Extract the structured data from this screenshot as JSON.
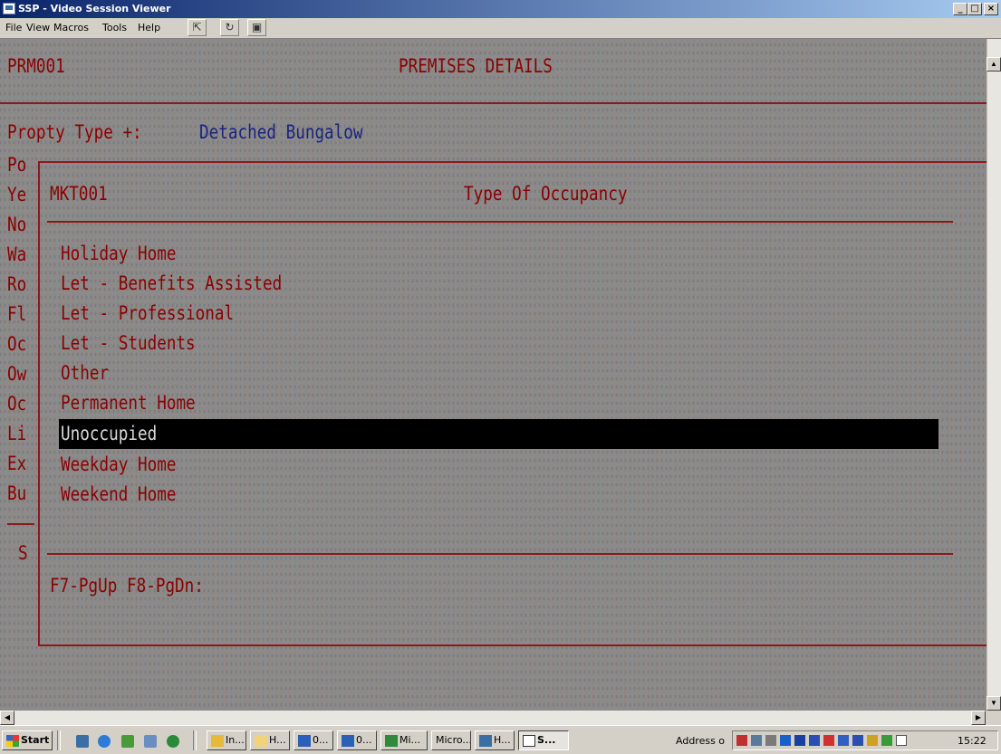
{
  "window": {
    "title": "SSP - Video Session Viewer"
  },
  "menu": [
    "File",
    "View",
    "Macros",
    "Tools",
    "Help"
  ],
  "screen": {
    "code": "PRM001",
    "title": "PREMISES DETAILS",
    "property_label": "Propty Type +:",
    "property_value": "Detached Bungalow",
    "side_labels": [
      "Po",
      "Ye",
      "No",
      "Wa",
      "Ro",
      "Fl",
      "Oc",
      "Ow",
      "Oc",
      "Li",
      "Ex",
      "Bu"
    ],
    "side_bottom": "S"
  },
  "popup": {
    "code": "MKT001",
    "title": "Type Of Occupancy",
    "options": [
      "Holiday Home",
      "Let - Benefits Assisted",
      "Let - Professional",
      "Let - Students",
      "Other",
      "Permanent Home",
      "Unoccupied",
      "Weekday Home",
      "Weekend Home"
    ],
    "selected": "Unoccupied",
    "footer": "F7-PgUp F8-PgDn:"
  },
  "taskbar": {
    "start": "Start",
    "tasks": [
      "In...",
      "H...",
      "0...",
      "0...",
      "Mi...",
      "Micro...",
      "H...",
      "S..."
    ],
    "address_label": "Address o",
    "clock": "15:22"
  },
  "colors": {
    "title_bar": "#0a246a",
    "terminal_bg": "#8b8b8b",
    "text_red": "#8b0000",
    "text_navy": "#1a237e",
    "selection_bg": "#000000"
  }
}
